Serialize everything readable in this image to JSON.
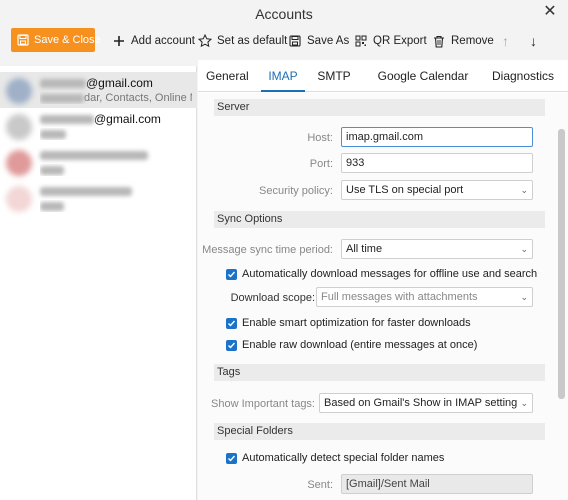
{
  "window": {
    "title": "Accounts",
    "close_glyph": "✕"
  },
  "toolbar": {
    "save_close": "Save & Close",
    "add_account": "Add account",
    "set_default": "Set as default",
    "save_as": "Save As",
    "qr_export": "QR Export",
    "remove": "Remove",
    "up_glyph": "↑",
    "down_glyph": "↓",
    "accent_color": "#f6911f"
  },
  "sidebar": {
    "accounts": [
      {
        "name": "@gmail.com",
        "sub": "dar, Contacts, Online M..."
      },
      {
        "name": "@gmail.com",
        "sub": ""
      },
      {
        "name": "",
        "sub": ""
      },
      {
        "name": "",
        "sub": ""
      }
    ]
  },
  "tabs": [
    "General",
    "IMAP",
    "SMTP",
    "Google Calendar",
    "Diagnostics"
  ],
  "active_tab": "IMAP",
  "server": {
    "heading": "Server",
    "host_label": "Host:",
    "host_value": "imap.gmail.com",
    "port_label": "Port:",
    "port_value": "933",
    "security_label": "Security policy:",
    "security_value": "Use TLS on special port"
  },
  "sync": {
    "heading": "Sync Options",
    "period_label": "Message sync time period:",
    "period_value": "All time",
    "auto_download": "Automatically download messages for offline use and search",
    "scope_label": "Download scope:",
    "scope_value": "Full messages with attachments",
    "smart_opt": "Enable smart optimization for faster downloads",
    "raw_download": "Enable raw download (entire messages at once)"
  },
  "tags": {
    "heading": "Tags",
    "important_label": "Show Important tags:",
    "important_value": "Based on Gmail's Show in IMAP setting"
  },
  "special": {
    "heading": "Special Folders",
    "auto_detect": "Automatically detect special folder names",
    "sent_label": "Sent:",
    "sent_value": "[Gmail]/Sent Mail"
  }
}
